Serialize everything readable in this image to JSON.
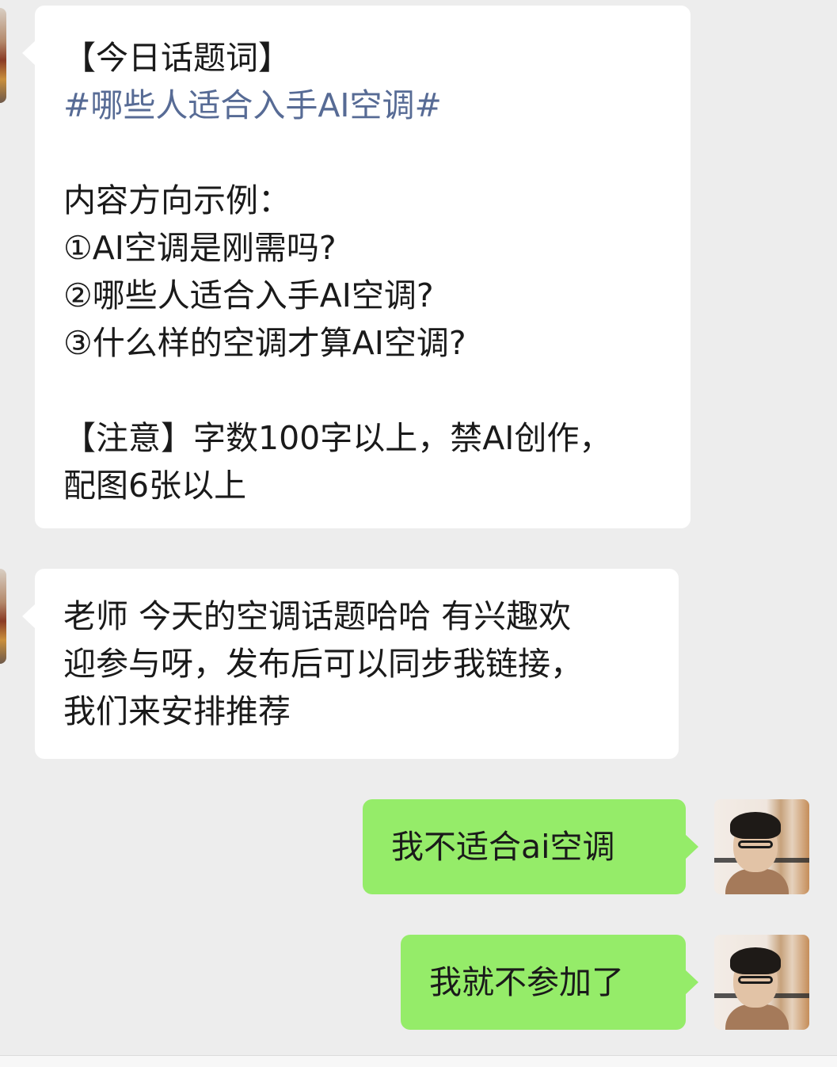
{
  "messages": [
    {
      "lines": [
        {
          "text": "【今日话题词】",
          "style": "normal"
        },
        {
          "text": "#哪些人适合入手AI空调#",
          "style": "hashtag"
        },
        {
          "text": "",
          "style": "blank"
        },
        {
          "text": "内容方向示例：",
          "style": "normal"
        },
        {
          "text": "①AI空调是刚需吗?",
          "style": "normal"
        },
        {
          "text": "②哪些人适合入手AI空调?",
          "style": "normal"
        },
        {
          "text": "③什么样的空调才算AI空调?",
          "style": "normal"
        },
        {
          "text": "",
          "style": "blank"
        },
        {
          "text": "【注意】字数100字以上，禁AI创作，",
          "style": "normal"
        },
        {
          "text": "配图6张以上",
          "style": "normal"
        }
      ]
    },
    {
      "lines": [
        {
          "text": "老师 今天的空调话题哈哈 有兴趣欢",
          "style": "normal"
        },
        {
          "text": "迎参与呀，发布后可以同步我链接，",
          "style": "normal"
        },
        {
          "text": "我们来安排推荐",
          "style": "normal"
        }
      ]
    },
    {
      "text": "我不适合ai空调"
    },
    {
      "text": "我就不参加了"
    }
  ],
  "colors": {
    "background": "#ededed",
    "incoming_bubble": "#ffffff",
    "outgoing_bubble": "#95ec69",
    "hashtag": "#576b95"
  }
}
